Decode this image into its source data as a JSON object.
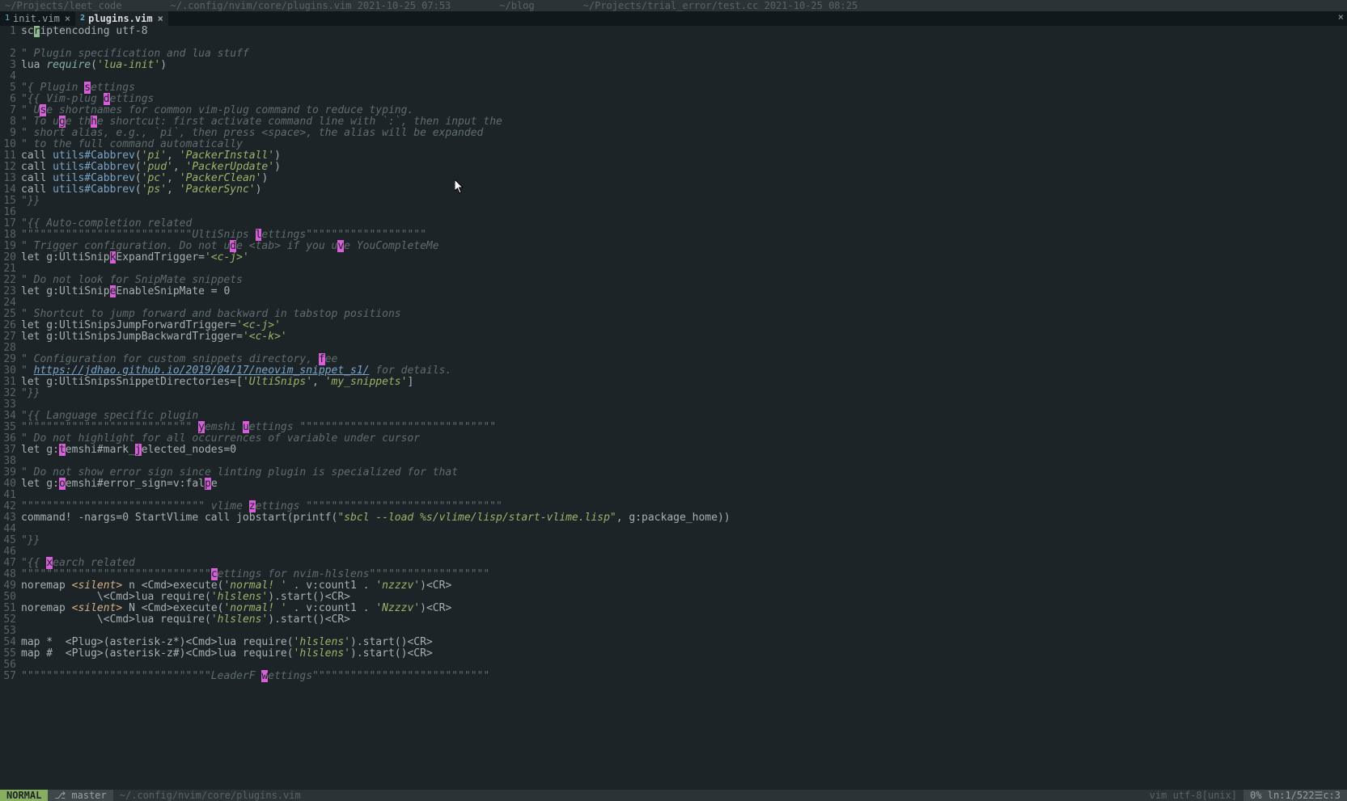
{
  "top": {
    "seg1": "~/Projects/leet_code",
    "seg2": "~/.config/nvim/core/plugins.vim 2021-10-25 07:53",
    "seg3": "~/blog",
    "seg4": "~/Projects/trial_error/test.cc 2021-10-25 08:25"
  },
  "tabs": {
    "t1_num": "1",
    "t1_name": "init.vim",
    "t2_num": "2",
    "t2_name": "plugins.vim"
  },
  "gutter": {
    "n1": "1",
    "n2": "2",
    "n3": "3",
    "n4": "4",
    "n5": "5",
    "n6": "6",
    "n7": "7",
    "n8": "8",
    "n9": "9",
    "n10": "10",
    "n11": "11",
    "n12": "12",
    "n13": "13",
    "n14": "14",
    "n15": "15",
    "n16": "16",
    "n17": "17",
    "n18": "18",
    "n19": "19",
    "n20": "20",
    "n21": "21",
    "n22": "22",
    "n23": "23",
    "n24": "24",
    "n25": "25",
    "n26": "26",
    "n27": "27",
    "n28": "28",
    "n29": "29",
    "n30": "30",
    "n31": "31",
    "n32": "32",
    "n33": "33",
    "n34": "34",
    "n35": "35",
    "n36": "36",
    "n37": "37",
    "n38": "38",
    "n39": "39",
    "n40": "40",
    "n41": "41",
    "n42": "42",
    "n43": "43",
    "n44": "44",
    "n45": "45",
    "n46": "46",
    "n47": "47",
    "n48": "48",
    "n49": "49",
    "n50": "50",
    "n51": "51",
    "n52": "52",
    "n53": "53",
    "n54": "54",
    "n55": "55",
    "n56": "56",
    "n57": "57"
  },
  "code": {
    "l1_a": "sc",
    "l1_b": "r",
    "l1_c": "iptencoding utf-8",
    "l2_a": "\" Plugin specification and lua stuff",
    "l3_a": "lua ",
    "l3_b": "require",
    "l3_c": "(",
    "l3_d": "'lua-init'",
    "l3_e": ")",
    "l5_a": "\"{ Plugin ",
    "l5_b": "s",
    "l5_c": "ettings",
    "l6_a": "\"{{ Vim-plug ",
    "l6_b": "d",
    "l6_c": "ettings",
    "l7_a": "\" U",
    "l7_b": "s",
    "l7_c": "e shortnames for common vim-plug command to reduce typing.",
    "l8_a": "\" To u",
    "l8_b": "g",
    "l8_c": "e th",
    "l8_d": "h",
    "l8_e": "e shortcut: first activate command line with `:`, then input the",
    "l9_a": "\" short alias, e.g., `pi`, then press <space>, the alias will be expanded",
    "l10_a": "\" to the full command automatically",
    "l11_a": "call ",
    "l11_b": "utils#Cabbrev",
    "l11_c": "(",
    "l11_d": "'pi'",
    "l11_e": ", ",
    "l11_f": "'PackerInstall'",
    "l11_g": ")",
    "l12_a": "call ",
    "l12_b": "utils#Cabbrev",
    "l12_c": "(",
    "l12_d": "'pud'",
    "l12_e": ", ",
    "l12_f": "'PackerUpdate'",
    "l12_g": ")",
    "l13_a": "call ",
    "l13_b": "utils#Cabbrev",
    "l13_c": "(",
    "l13_d": "'pc'",
    "l13_e": ", ",
    "l13_f": "'PackerClean'",
    "l13_g": ")",
    "l14_a": "call ",
    "l14_b": "utils#Cabbrev",
    "l14_c": "(",
    "l14_d": "'ps'",
    "l14_e": ", ",
    "l14_f": "'PackerSync'",
    "l14_g": ")",
    "l15_a": "\"}}",
    "l17_a": "\"{{ Auto-completion related",
    "l18_a": "\"\"\"\"\"\"\"\"\"\"\"\"\"\"\"\"\"\"\"\"\"\"\"\"\"\"\"UltiSnips ",
    "l18_b": "l",
    "l18_c": "ettings\"\"\"\"\"\"\"\"\"\"\"\"\"\"\"\"\"\"\"",
    "l19_a": "\" Trigger configuration. Do not u",
    "l19_b": "d",
    "l19_c": "e <tab> if you u",
    "l19_d": "v",
    "l19_e": "e YouCompleteMe",
    "l20_a": "let g:UltiSnip",
    "l20_b": "k",
    "l20_c": "ExpandTrigger=",
    "l20_d": "'<c-j>'",
    "l22_a": "\" Do not look for SnipMate snippets",
    "l23_a": "let g:UltiSnip",
    "l23_b": "e",
    "l23_c": "EnableSnipMate = 0",
    "l25_a": "\" Shortcut to jump forward and backward in tabstop positions",
    "l26_a": "let g:UltiSnipsJumpForwardTrigger=",
    "l26_b": "'<c-j>'",
    "l27_a": "let g:UltiSnipsJumpBackwardTrigger=",
    "l27_b": "'<c-k>'",
    "l29_a": "\" Configuration for custom snippets directory, ",
    "l29_b": "f",
    "l29_c": "ee",
    "l30_a": "\" ",
    "l30_b": "https://jdhao.github.io/2019/04/17/neovim_snippet_s1/",
    "l30_c": " for details.",
    "l31_a": "let g:UltiSnipsSnippetDirectories=[",
    "l31_b": "'UltiSnips'",
    "l31_c": ", ",
    "l31_d": "'my_snippets'",
    "l31_e": "]",
    "l32_a": "\"}}",
    "l34_a": "\"{{ Language specific plugin",
    "l35_a": "\"\"\"\"\"\"\"\"\"\"\"\"\"\"\"\"\"\"\"\"\"\"\"\"\"\"\" ",
    "l35_b": "y",
    "l35_c": "emshi ",
    "l35_d": "u",
    "l35_e": "ettings \"\"\"\"\"\"\"\"\"\"\"\"\"\"\"\"\"\"\"\"\"\"\"\"\"\"\"\"\"\"\"",
    "l36_a": "\" Do not highlight for all occurrences of variable under cursor",
    "l37_a": "let g:",
    "l37_b": "t",
    "l37_c": "emshi#mark_",
    "l37_d": "j",
    "l37_e": "elected_nodes=0",
    "l39_a": "\" Do not show error sign since linting plugin is specialized for that",
    "l40_a": "let g:",
    "l40_b": "o",
    "l40_c": "emshi#error_sign=v:fal",
    "l40_d": "p",
    "l40_e": "e",
    "l42_a": "\"\"\"\"\"\"\"\"\"\"\"\"\"\"\"\"\"\"\"\"\"\"\"\"\"\"\"\"\" vlime ",
    "l42_b": "z",
    "l42_c": "ettings \"\"\"\"\"\"\"\"\"\"\"\"\"\"\"\"\"\"\"\"\"\"\"\"\"\"\"\"\"\"\"",
    "l43_a": "command! -nargs=0 StartVlime call jobstart(printf(",
    "l43_b": "\"sbcl --load %s/vlime/lisp/start-vlime.lisp\"",
    "l43_c": ", g:package_home))",
    "l45_a": "\"}}",
    "l47_a": "\"{{ ",
    "l47_b": "x",
    "l47_c": "earch related",
    "l48_a": "\"\"\"\"\"\"\"\"\"\"\"\"\"\"\"\"\"\"\"\"\"\"\"\"\"\"\"\"\"\"",
    "l48_b": "c",
    "l48_c": "ettings for nvim-hlslens\"\"\"\"\"\"\"\"\"\"\"\"\"\"\"\"\"\"\"",
    "l49_a": "noremap ",
    "l49_b": "<silent>",
    "l49_c": " n <Cmd>execute(",
    "l49_d": "'normal! '",
    "l49_e": " . v:count1 . ",
    "l49_f": "'nzzzv'",
    "l49_g": ")<CR>",
    "l50_a": "            \\<Cmd>lua require(",
    "l50_b": "'hlslens'",
    "l50_c": ").start()<CR>",
    "l51_a": "noremap ",
    "l51_b": "<silent>",
    "l51_c": " N <Cmd>execute(",
    "l51_d": "'normal! '",
    "l51_e": " . v:count1 . ",
    "l51_f": "'Nzzzv'",
    "l51_g": ")<CR>",
    "l52_a": "            \\<Cmd>lua require(",
    "l52_b": "'hlslens'",
    "l52_c": ").start()<CR>",
    "l54_a": "map *  <Plug>(asterisk-z*)<Cmd>lua require(",
    "l54_b": "'hlslens'",
    "l54_c": ").start()<CR>",
    "l55_a": "map #  <Plug>(asterisk-z#)<Cmd>lua require(",
    "l55_b": "'hlslens'",
    "l55_c": ").start()<CR>",
    "l57_a": "\"\"\"\"\"\"\"\"\"\"\"\"\"\"\"\"\"\"\"\"\"\"\"\"\"\"\"\"\"\"LeaderF ",
    "l57_b": "w",
    "l57_c": "ettings\"\"\"\"\"\"\"\"\"\"\"\"\"\"\"\"\"\"\"\"\"\"\"\"\"\"\"\""
  },
  "status": {
    "mode": "NORMAL",
    "branch": "⎇ master",
    "path": "~/.config/nvim/core/plugins.vim",
    "ff": "vim  utf-8[unix]",
    "pct": "0% ln:1/522☰c:3",
    "pos": ""
  }
}
